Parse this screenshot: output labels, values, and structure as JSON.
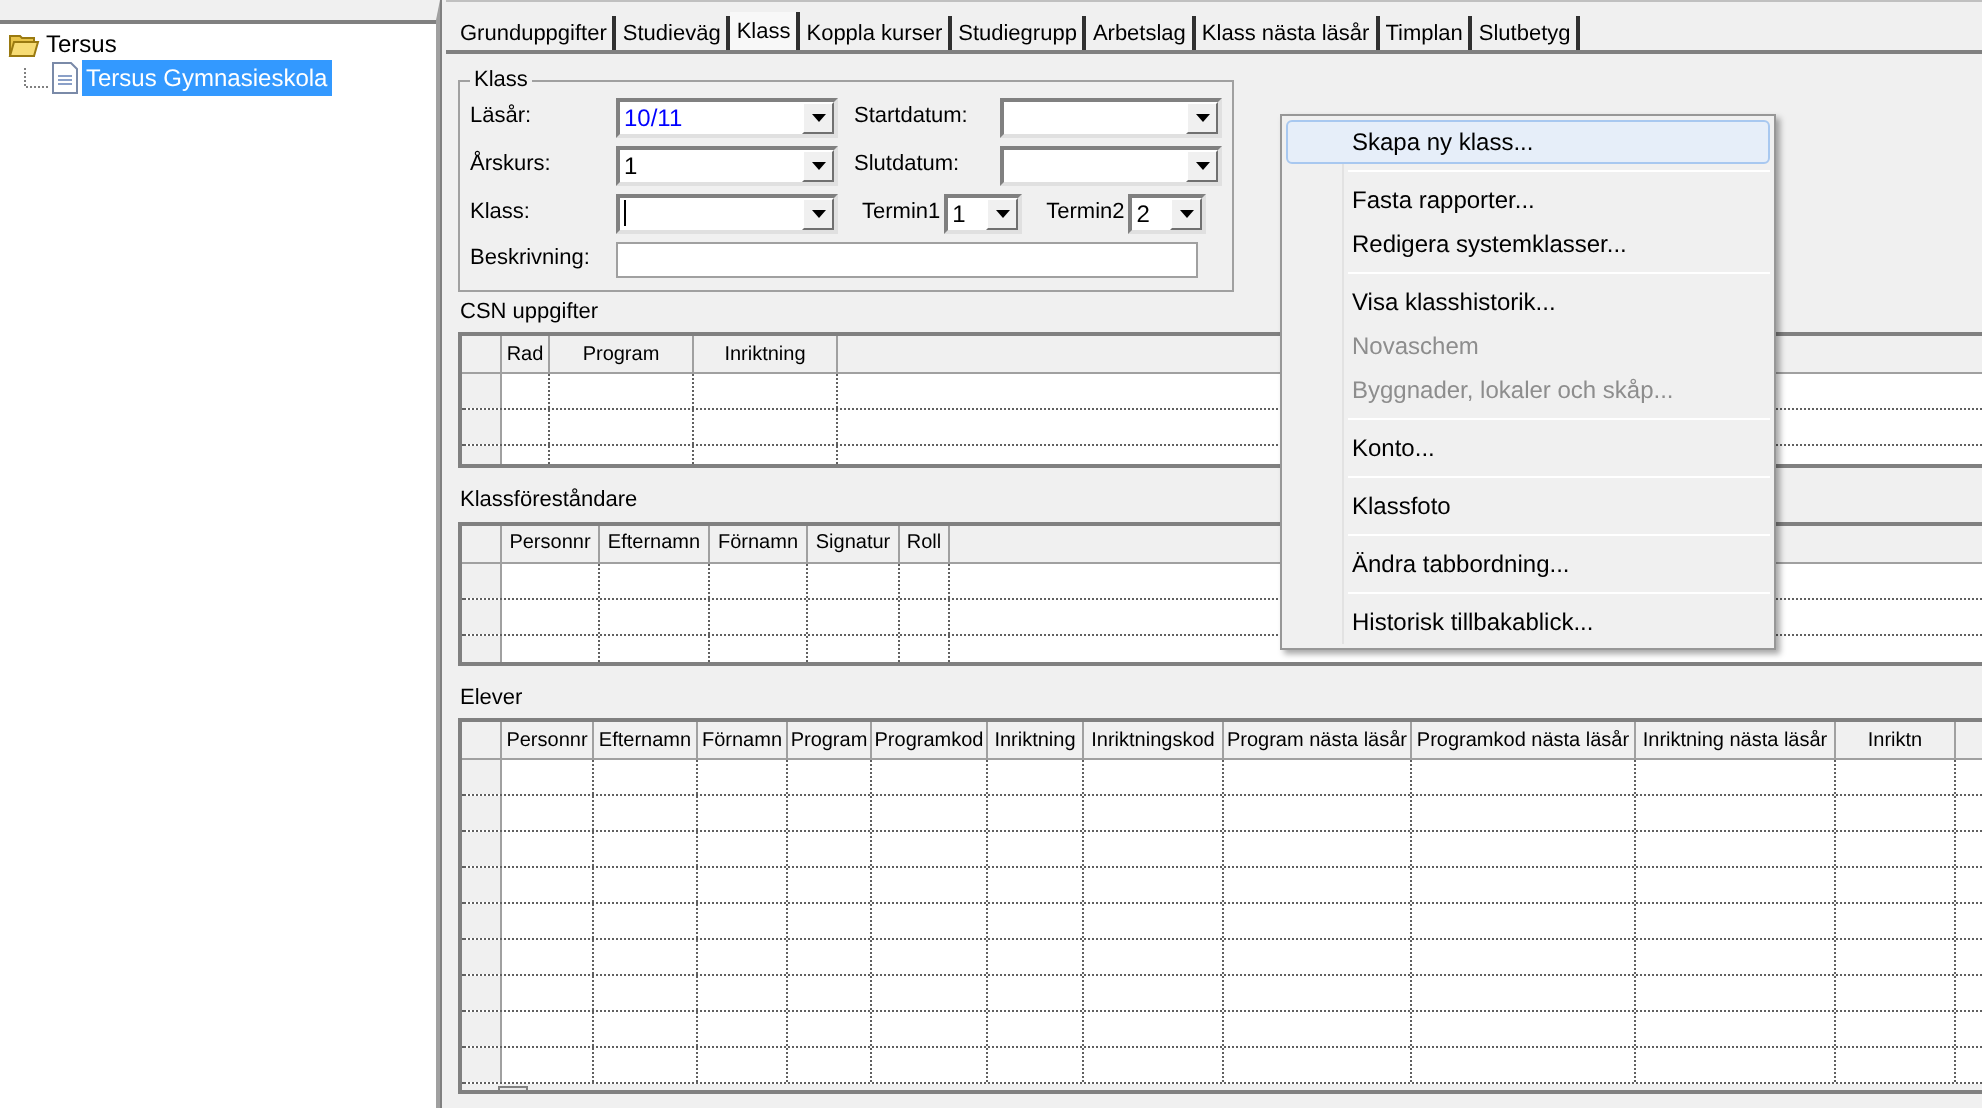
{
  "tree": {
    "label": "Tersus",
    "expanded": true,
    "children": [
      {
        "label": "Tersus Gymnasieskola",
        "selected": true
      }
    ]
  },
  "tabs": [
    {
      "label": "Grunduppgifter",
      "selected": false
    },
    {
      "label": "Studieväg",
      "selected": false
    },
    {
      "label": "Klass",
      "selected": true
    },
    {
      "label": "Koppla kurser",
      "selected": false
    },
    {
      "label": "Studiegrupp",
      "selected": false
    },
    {
      "label": "Arbetslag",
      "selected": false
    },
    {
      "label": "Klass nästa läsår",
      "selected": false
    },
    {
      "label": "Timplan",
      "selected": false
    },
    {
      "label": "Slutbetyg",
      "selected": false
    }
  ],
  "form": {
    "title": "Klass",
    "rows": [
      [
        {
          "kind": "combo",
          "label": "Läsår:",
          "value": "10/11"
        },
        {
          "kind": "combo",
          "label": "Startdatum:"
        }
      ],
      [
        {
          "kind": "combo",
          "label": "Årskurs:",
          "value": "1"
        },
        {
          "kind": "combo",
          "label": "Slutdatum:"
        }
      ],
      [
        {
          "kind": "combo",
          "label": "Klass:",
          "focused": true
        },
        {
          "kind": "small_combo",
          "label": "Termin1",
          "value": "1"
        },
        {
          "kind": "small_combo",
          "label": "Termin2",
          "value": "2"
        }
      ],
      [
        {
          "kind": "text",
          "label": "Beskrivning:"
        }
      ]
    ]
  },
  "grids": [
    {
      "title": "CSN uppgifter",
      "columns": [
        "Rad",
        "Program",
        "Inriktning"
      ]
    },
    {
      "title": "Klassföreståndare",
      "columns": [
        "Personnr",
        "Efternamn",
        "Förnamn",
        "Signatur",
        "Roll"
      ]
    },
    {
      "title": "Elever",
      "columns": [
        "Personnr",
        "Efternamn",
        "Förnamn",
        "Program",
        "Programkod",
        "Inriktning",
        "Inriktningskod",
        "Program nästa läsår",
        "Programkod nästa läsår",
        "Inriktning nästa läsår",
        "Inriktn"
      ]
    }
  ],
  "context_menu": [
    {
      "kind": "item",
      "label": "Skapa ny klass...",
      "disabled": false,
      "selected": true
    },
    {
      "kind": "separator"
    },
    {
      "kind": "item",
      "label": "Fasta rapporter...",
      "disabled": false,
      "selected": false
    },
    {
      "kind": "item",
      "label": "Redigera systemklasser...",
      "disabled": false,
      "selected": false
    },
    {
      "kind": "separator"
    },
    {
      "kind": "item",
      "label": "Visa klasshistorik...",
      "disabled": false,
      "selected": false
    },
    {
      "kind": "item",
      "label": "Novaschem",
      "disabled": true,
      "selected": false
    },
    {
      "kind": "item",
      "label": "Byggnader, lokaler och skåp...",
      "disabled": true,
      "selected": false
    },
    {
      "kind": "separator"
    },
    {
      "kind": "item",
      "label": "Konto...",
      "disabled": false,
      "selected": false
    },
    {
      "kind": "separator"
    },
    {
      "kind": "item",
      "label": "Klassfoto",
      "disabled": false,
      "selected": false
    },
    {
      "kind": "separator"
    },
    {
      "kind": "item",
      "label": "Ändra tabbordning...",
      "disabled": false,
      "selected": false
    },
    {
      "kind": "separator"
    },
    {
      "kind": "item",
      "label": "Historisk tillbakablick...",
      "disabled": false,
      "selected": false
    }
  ]
}
